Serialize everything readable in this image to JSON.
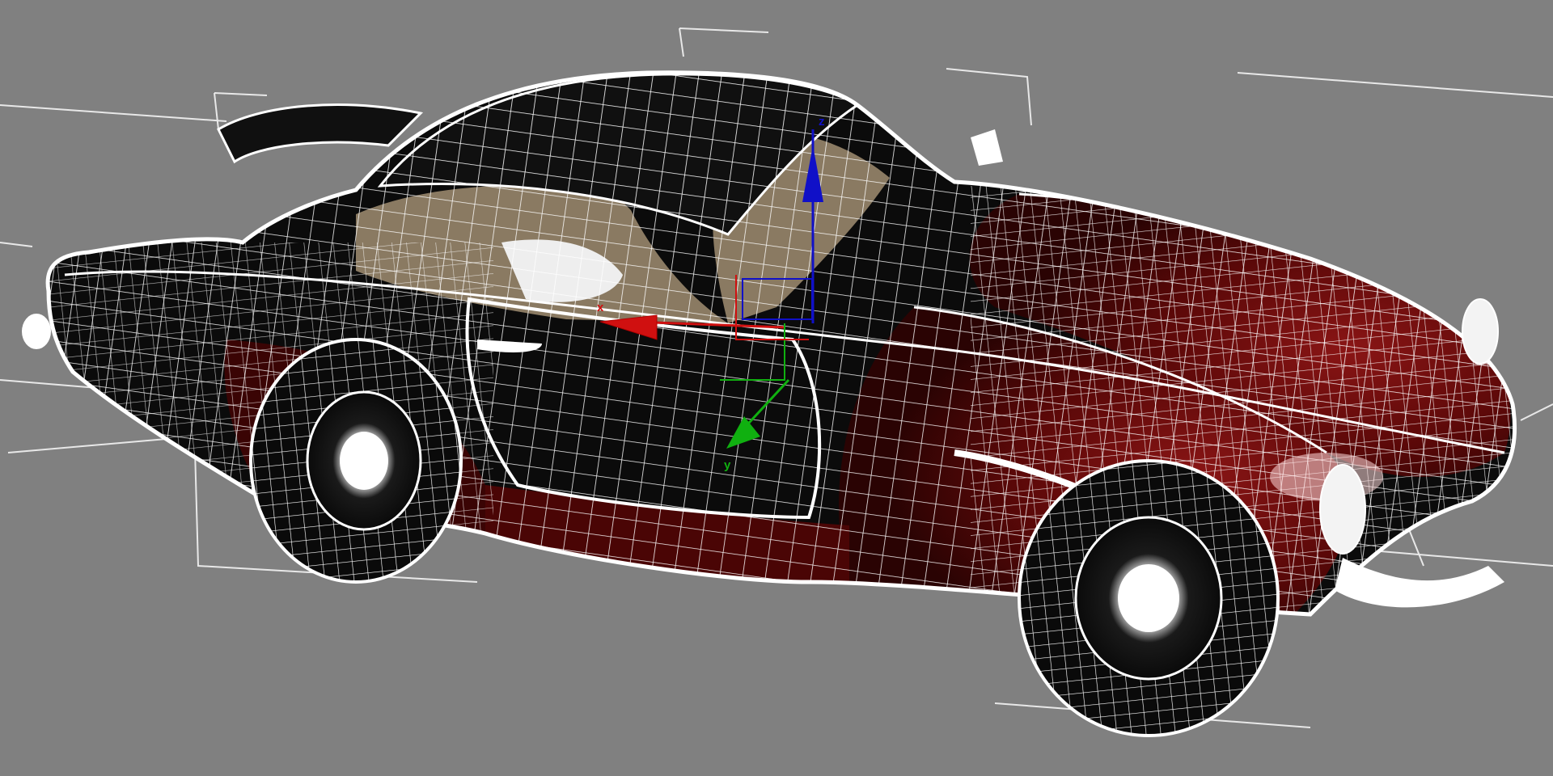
{
  "viewport": {
    "background_color": "#808080",
    "wire_color": "#ffffff",
    "body_color": "#0b0b0b",
    "paint_color": "#6e0a0a",
    "interior_color": "#8a7a62"
  },
  "gizmo": {
    "x_label": "x",
    "y_label": "y",
    "z_label": "z",
    "x_color": "#d01010",
    "y_color": "#10b010",
    "z_color": "#1010c8"
  }
}
